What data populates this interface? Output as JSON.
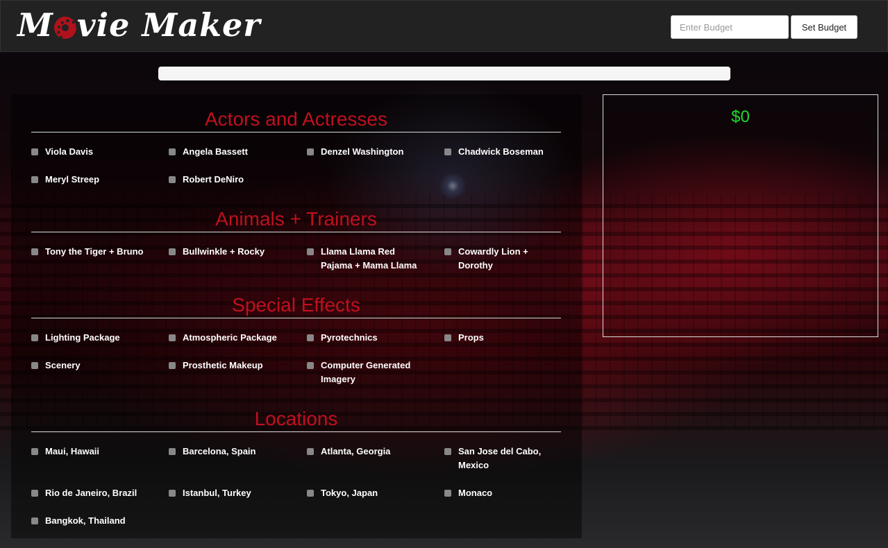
{
  "header": {
    "logo_text_left": "M",
    "logo_text_right": "vie Maker",
    "budget_placeholder": "Enter Budget",
    "set_budget_label": "Set Budget"
  },
  "progress": {
    "fraction": 0
  },
  "summary": {
    "total": "$0"
  },
  "sections": [
    {
      "title": "Actors and Actresses",
      "options": [
        "Viola Davis",
        "Angela Bassett",
        "Denzel Washington",
        "Chadwick Boseman",
        "Meryl Streep",
        "Robert DeNiro"
      ]
    },
    {
      "title": "Animals + Trainers",
      "options": [
        "Tony the Tiger + Bruno",
        "Bullwinkle + Rocky",
        "Llama Llama Red Pajama + Mama Llama",
        "Cowardly Lion + Dorothy"
      ]
    },
    {
      "title": "Special Effects",
      "options": [
        "Lighting Package",
        "Atmospheric Package",
        "Pyrotechnics",
        "Props",
        "Scenery",
        "Prosthetic Makeup",
        "Computer Generated Imagery"
      ]
    },
    {
      "title": "Locations",
      "options": [
        "Maui, Hawaii",
        "Barcelona, Spain",
        "Atlanta, Georgia",
        "San Jose del Cabo, Mexico",
        "Rio de Janeiro, Brazil",
        "Istanbul, Turkey",
        "Tokyo, Japan",
        "Monaco",
        "Bangkok, Thailand"
      ]
    }
  ],
  "colors": {
    "section_title": "#c0101e",
    "total": "#1fdc2c",
    "header_bg": "#222222"
  }
}
